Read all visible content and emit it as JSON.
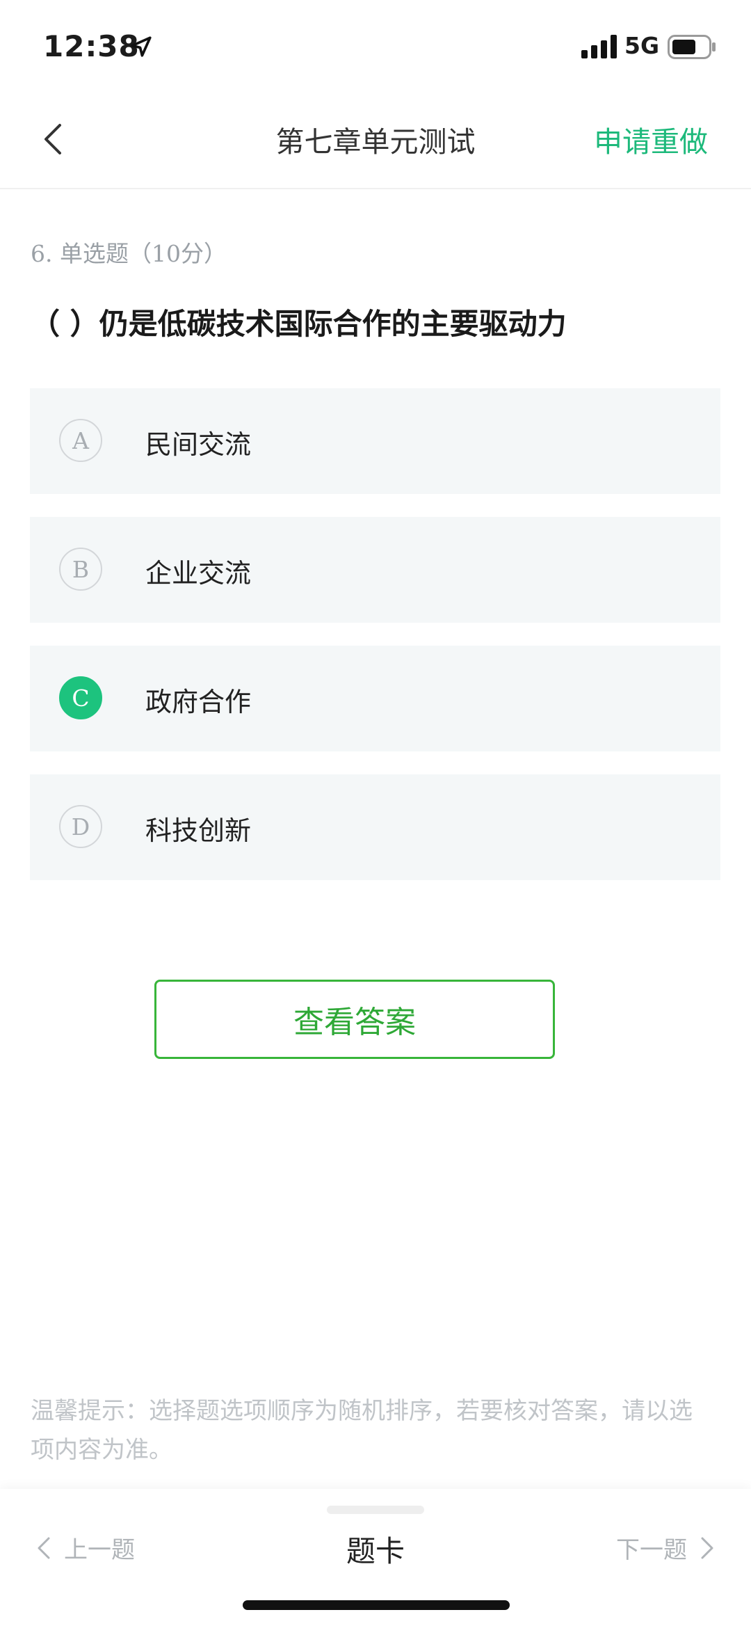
{
  "status": {
    "time": "12:38",
    "network": "5G"
  },
  "nav": {
    "title": "第七章单元测试",
    "redo_label": "申请重做"
  },
  "question": {
    "meta": "6. 单选题（10分）",
    "text": "（ ）仍是低碳技术国际合作的主要驱动力",
    "options": [
      {
        "letter": "A",
        "text": "民间交流",
        "selected": false
      },
      {
        "letter": "B",
        "text": "企业交流",
        "selected": false
      },
      {
        "letter": "C",
        "text": "政府合作",
        "selected": true
      },
      {
        "letter": "D",
        "text": "科技创新",
        "selected": false
      }
    ]
  },
  "view_answer_label": "查看答案",
  "tip": "温馨提示：选择题选项顺序为随机排序，若要核对答案，请以选项内容为准。",
  "bottom": {
    "prev_label": "上一题",
    "card_label": "题卡",
    "next_label": "下一题"
  },
  "colors": {
    "accent": "#1dc37e",
    "button_green": "#38b53a",
    "option_bg": "#f4f7f8"
  },
  "icons": [
    "location-arrow-icon",
    "signal-icon",
    "battery-icon",
    "chevron-left-icon",
    "chevron-right-icon"
  ]
}
